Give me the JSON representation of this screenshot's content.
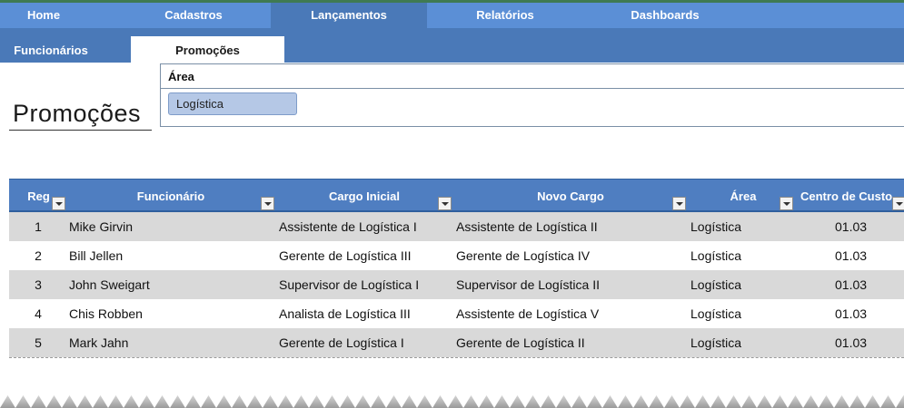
{
  "nav": {
    "items": [
      {
        "label": "Home",
        "active": false
      },
      {
        "label": "Cadastros",
        "active": false
      },
      {
        "label": "Lançamentos",
        "active": true
      },
      {
        "label": "Relatórios",
        "active": false
      },
      {
        "label": "Dashboards",
        "active": false
      }
    ]
  },
  "subnav": {
    "items": [
      {
        "label": "Funcionários",
        "active": false
      },
      {
        "label": "Promoções",
        "active": true
      }
    ]
  },
  "page": {
    "title": "Promoções"
  },
  "slicer": {
    "header": "Área",
    "selected": "Logística"
  },
  "table": {
    "columns": [
      "Reg",
      "Funcionário",
      "Cargo Inicial",
      "Novo Cargo",
      "Área",
      "Centro de Custo"
    ],
    "rows": [
      [
        "1",
        "Mike Girvin",
        "Assistente de Logística I",
        "Assistente de Logística II",
        "Logística",
        "01.03"
      ],
      [
        "2",
        "Bill Jellen",
        "Gerente de Logística III",
        "Gerente de Logística IV",
        "Logística",
        "01.03"
      ],
      [
        "3",
        "John Sweigart",
        "Supervisor de Logística I",
        "Supervisor de Logística II",
        "Logística",
        "01.03"
      ],
      [
        "4",
        "Chis Robben",
        "Analista de Logística III",
        "Assistente de Logística V",
        "Logística",
        "01.03"
      ],
      [
        "5",
        "Mark Jahn",
        "Gerente de Logística I",
        "Gerente de Logística II",
        "Logística",
        "01.03"
      ]
    ]
  },
  "colors": {
    "nav_bg": "#5b8fd6",
    "nav_active": "#4a79b8",
    "subnav_bg": "#4a79b8",
    "header_bg": "#4f7ec1",
    "row_shaded": "#d9d9d9",
    "slicer_selected": "#b5c8e6"
  }
}
